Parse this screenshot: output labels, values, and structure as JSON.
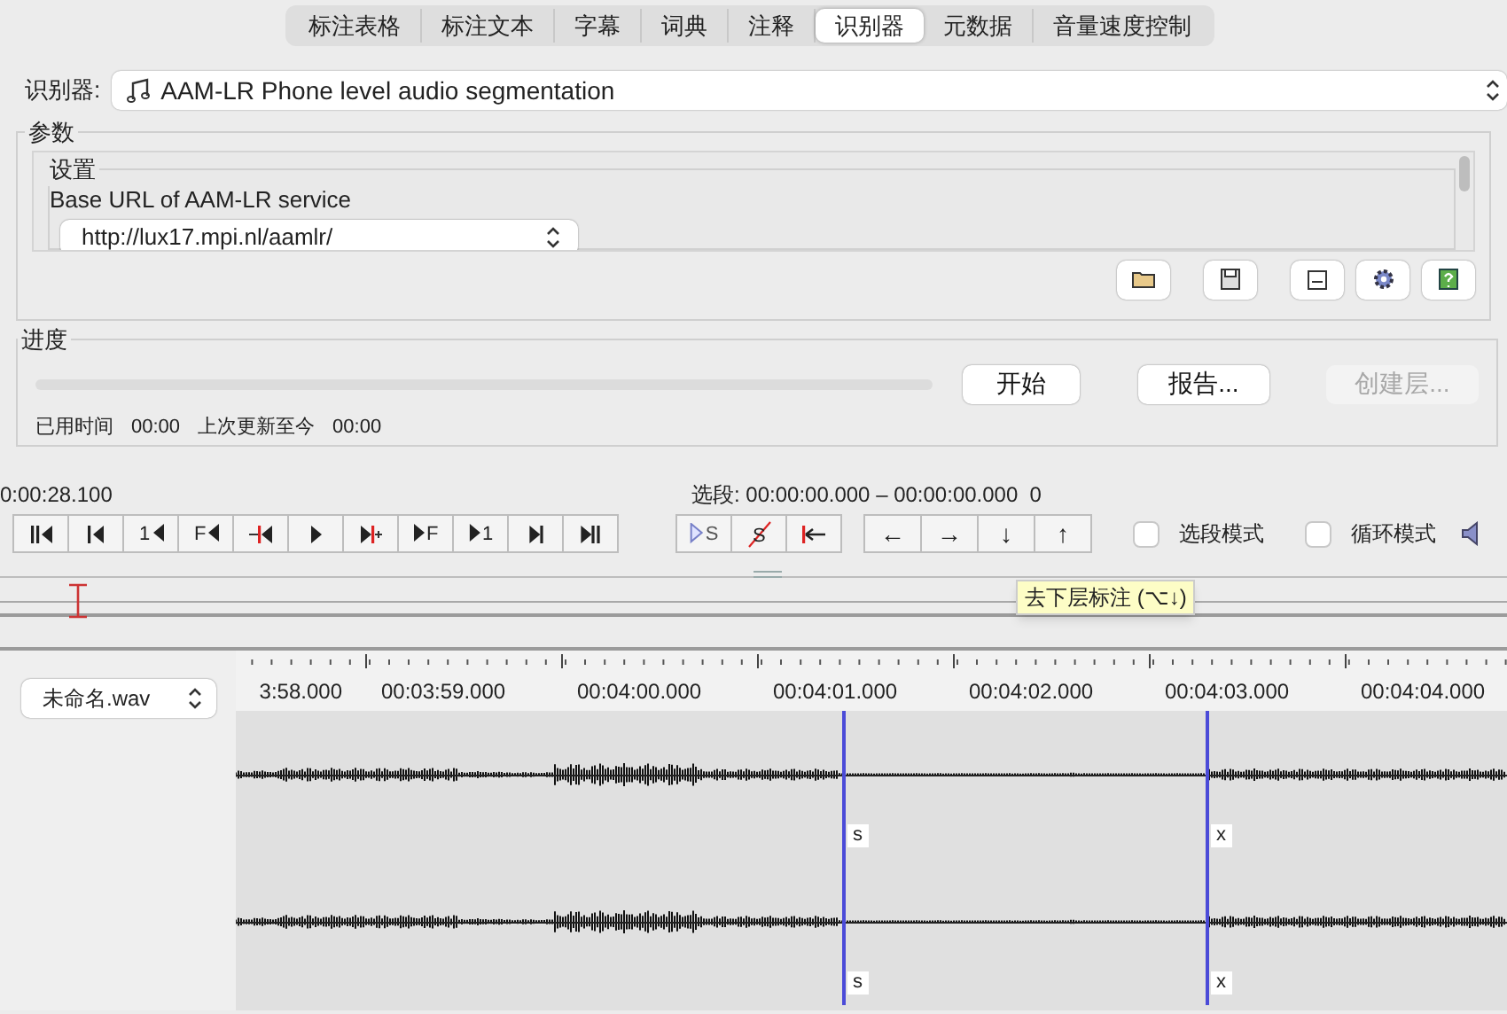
{
  "tabs": [
    {
      "label": "标注表格",
      "selected": false
    },
    {
      "label": "标注文本",
      "selected": false
    },
    {
      "label": "字幕",
      "selected": false
    },
    {
      "label": "词典",
      "selected": false
    },
    {
      "label": "注释",
      "selected": false
    },
    {
      "label": "识别器",
      "selected": true
    },
    {
      "label": "元数据",
      "selected": false
    },
    {
      "label": "音量速度控制",
      "selected": false
    }
  ],
  "recognizer": {
    "label": "识别器:",
    "value": "AAM-LR Phone level audio segmentation"
  },
  "parameters": {
    "title": "参数",
    "settings": {
      "title": "设置",
      "field_label": "Base URL of AAM-LR service",
      "url": "http://lux17.mpi.nl/aamlr/"
    }
  },
  "progress": {
    "title": "进度",
    "level": 0,
    "buttons": [
      {
        "label": "开始",
        "disabled": false
      },
      {
        "label": "报告...",
        "disabled": false
      },
      {
        "label": "创建层...",
        "disabled": true
      }
    ],
    "elapsed_label": "已用时间",
    "elapsed": "00:00",
    "since_label": "上次更新至今",
    "since": "00:00"
  },
  "media": {
    "time": "0:00:28.100",
    "selection": "选段: 00:00:00.000 – 00:00:00.000  0",
    "transport": [
      {
        "kind": "start"
      },
      {
        "kind": "previous"
      },
      {
        "kind": "back",
        "text": "1"
      },
      {
        "kind": "back",
        "text": "F"
      },
      {
        "kind": "back-to-mark"
      },
      {
        "kind": "play"
      },
      {
        "kind": "play-around"
      },
      {
        "kind": "forward",
        "text": "F"
      },
      {
        "kind": "forward",
        "text": "1"
      },
      {
        "kind": "next"
      },
      {
        "kind": "end"
      }
    ],
    "selection_buttons": [
      {
        "kind": "play-selection",
        "text": "S"
      },
      {
        "kind": "clear-selection",
        "text": "S"
      },
      {
        "kind": "to-begin"
      }
    ],
    "arrows": [
      "←",
      "→",
      "↓",
      "↑"
    ],
    "modes": [
      {
        "label": "选段模式",
        "checked": false
      },
      {
        "label": "循环模式",
        "checked": false
      }
    ],
    "tooltip": "去下层标注 (⌥↓)"
  },
  "timeline": {
    "file": "未命名.wav",
    "ruler": [
      "3:58.000",
      "00:03:59.000",
      "00:04:00.000",
      "00:04:01.000",
      "00:04:02.000",
      "00:04:03.000",
      "00:04:04.000"
    ],
    "tracks": [
      {
        "markers": [
          "s",
          "x"
        ]
      },
      {
        "markers": [
          "s",
          "x"
        ]
      }
    ]
  }
}
